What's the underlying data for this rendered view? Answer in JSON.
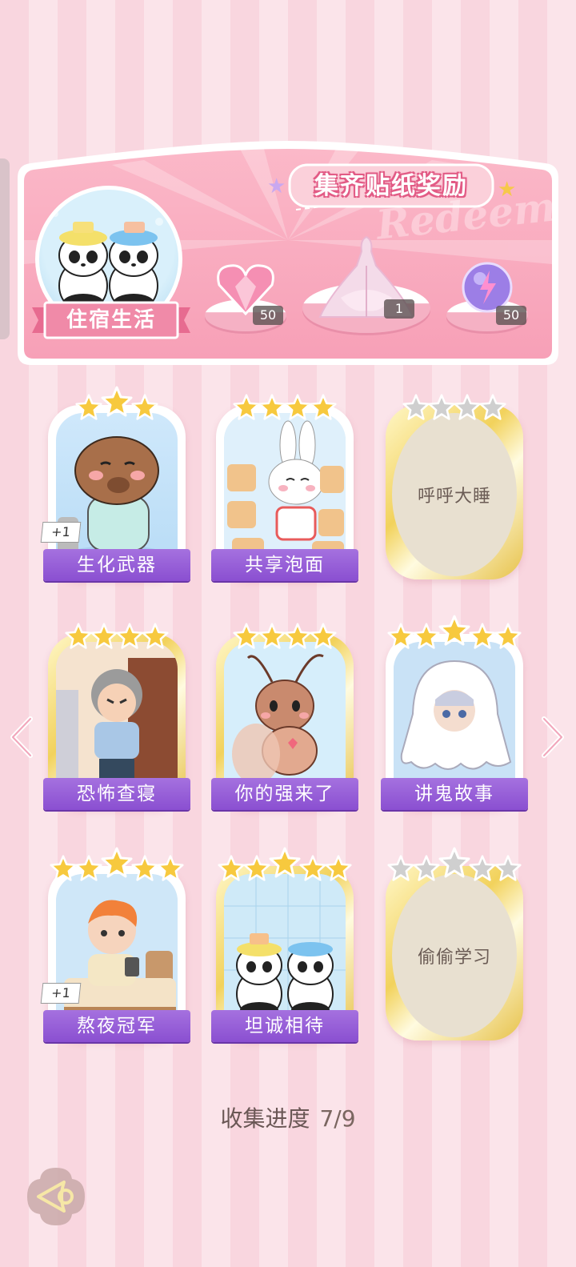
{
  "banner": {
    "title": "集齐贴纸奖励",
    "watermark": "Redeem",
    "theme_label": "住宿生活",
    "rewards": [
      {
        "name": "pink-heart-gem-icon",
        "count": "50"
      },
      {
        "name": "dress-outfit-icon",
        "count": "1"
      },
      {
        "name": "purple-energy-orb-icon",
        "count": "50"
      }
    ]
  },
  "cards": [
    {
      "label": "生化武器",
      "stars": 3,
      "plus": "+1",
      "frame": "white",
      "locked": false,
      "art": "capybara"
    },
    {
      "label": "共享泡面",
      "stars": 4,
      "frame": "white",
      "locked": false,
      "art": "bunny-noodles"
    },
    {
      "label": "呼呼大睡",
      "stars": 4,
      "frame": "gold",
      "locked": true
    },
    {
      "label": "恐怖查寝",
      "stars": 4,
      "frame": "gold",
      "locked": false,
      "art": "dorm-auntie"
    },
    {
      "label": "你的强来了",
      "stars": 4,
      "frame": "gold",
      "locked": false,
      "art": "cockroach"
    },
    {
      "label": "讲鬼故事",
      "stars": 5,
      "frame": "white",
      "locked": false,
      "art": "ghost"
    },
    {
      "label": "熬夜冠军",
      "stars": 5,
      "plus": "+1",
      "frame": "white",
      "locked": false,
      "art": "boy-bed"
    },
    {
      "label": "坦诚相待",
      "stars": 5,
      "frame": "gold",
      "locked": false,
      "art": "pandas-bath"
    },
    {
      "label": "偷偷学习",
      "stars": 5,
      "frame": "gold",
      "locked": true
    }
  ],
  "progress": {
    "label": "收集进度",
    "value": "7/9"
  },
  "colors": {
    "purple": "#8a4fd1",
    "pink": "#f08aa8",
    "gold": "#f5c84a"
  }
}
